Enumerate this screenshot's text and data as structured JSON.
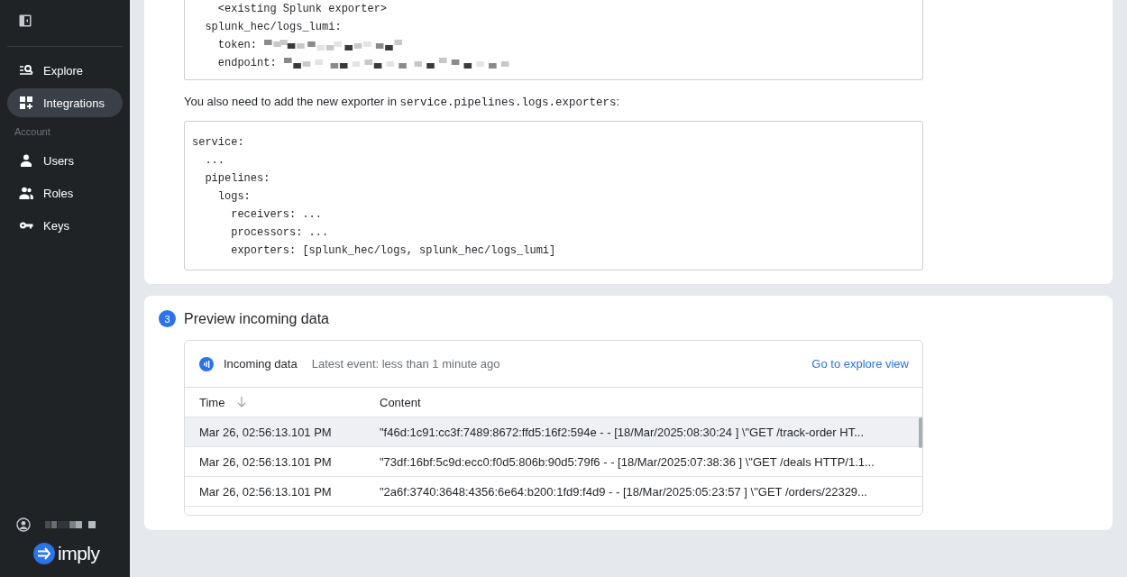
{
  "sidebar": {
    "main_items": [
      {
        "label": "Explore",
        "selected": false
      },
      {
        "label": "Integrations",
        "selected": true
      }
    ],
    "section_title": "Account",
    "account_items": [
      {
        "label": "Users",
        "selected": false
      },
      {
        "label": "Roles",
        "selected": false
      },
      {
        "label": "Keys",
        "selected": false
      }
    ],
    "brand": "imply"
  },
  "config_card": {
    "code_block_1": [
      {
        "text": "    <existing Splunk exporter>"
      },
      {
        "text": "  splunk_hec/logs_lumi:"
      },
      {
        "text": "    token:",
        "redacted": true
      },
      {
        "text": "    endpoint:",
        "redacted": true
      }
    ],
    "instruction": [
      {
        "kind": "text",
        "text": "You also need to add the new exporter in "
      },
      {
        "kind": "code",
        "text": "service.pipelines.logs.exporters"
      },
      {
        "kind": "text",
        "text": ":"
      }
    ],
    "code_block_2": [
      "service:",
      "  ...",
      "  pipelines:",
      "    logs:",
      "      receivers: ...",
      "      processors: ...",
      "      exporters: [splunk_hec/logs, splunk_hec/logs_lumi]"
    ]
  },
  "preview_card": {
    "step": "3",
    "title": "Preview incoming data",
    "panel": {
      "title": "Incoming data",
      "latest_event": "Latest event: less than 1 minute ago",
      "link": "Go to explore view",
      "columns": [
        "Time",
        "Content"
      ],
      "rows": [
        {
          "time": "Mar 26, 02:56:13.101 PM",
          "content": "\"f46d:1c91:cc3f:7489:8672:ffd5:16f2:594e - - [18/Mar/2025:08:30:24 ] \\\"GET /track-order HT...",
          "selected": true
        },
        {
          "time": "Mar 26, 02:56:13.101 PM",
          "content": "\"73df:16bf:5c9d:ecc0:f0d5:806b:90d5:79f6 - - [18/Mar/2025:07:38:36 ] \\\"GET /deals HTTP/1.1...",
          "selected": false
        },
        {
          "time": "Mar 26, 02:56:13.101 PM",
          "content": "\"2a6f:3740:3648:4356:6e64:b200:1fd9:f4d9 - - [18/Mar/2025:05:23:57 ] \\\"GET /orders/22329...",
          "selected": false
        }
      ]
    }
  }
}
